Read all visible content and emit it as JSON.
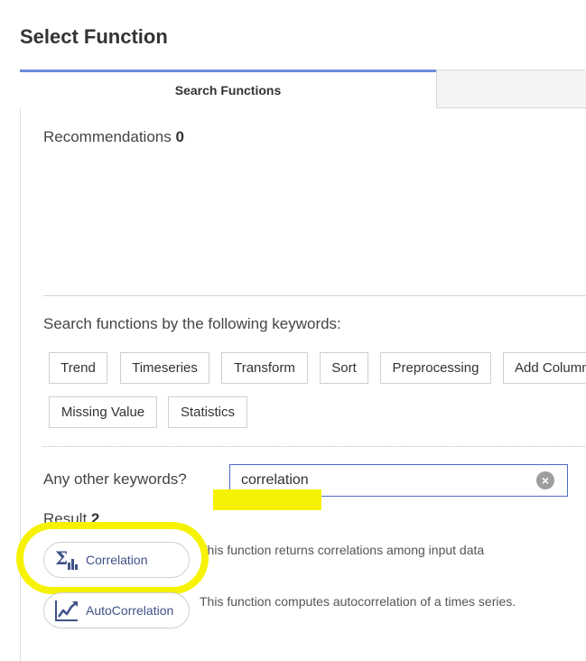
{
  "dialog": {
    "title": "Select Function"
  },
  "tabs": [
    {
      "label": "Search Functions",
      "active": true
    },
    {
      "label": "",
      "active": false
    }
  ],
  "recommendations": {
    "label": "Recommendations",
    "count": "0"
  },
  "keywords": {
    "label": "Search functions by the following keywords:",
    "items": [
      "Trend",
      "Timeseries",
      "Transform",
      "Sort",
      "Preprocessing",
      "Add Column",
      "Missing Value",
      "Statistics"
    ]
  },
  "other_keywords": {
    "label": "Any other keywords?",
    "value": "correlation"
  },
  "result": {
    "label": "Result",
    "count": "2",
    "items": [
      {
        "name": "Correlation",
        "icon": "sigma-bar-chart-icon",
        "description": "This function returns correlations among input data"
      },
      {
        "name": "AutoCorrelation",
        "icon": "line-trend-icon",
        "description": "This function computes autocorrelation of a times series."
      }
    ]
  },
  "colors": {
    "accent": "#6b8ad8",
    "input_border": "#4c6bc7",
    "icon": "#3f5288",
    "highlight": "#f6f203"
  }
}
